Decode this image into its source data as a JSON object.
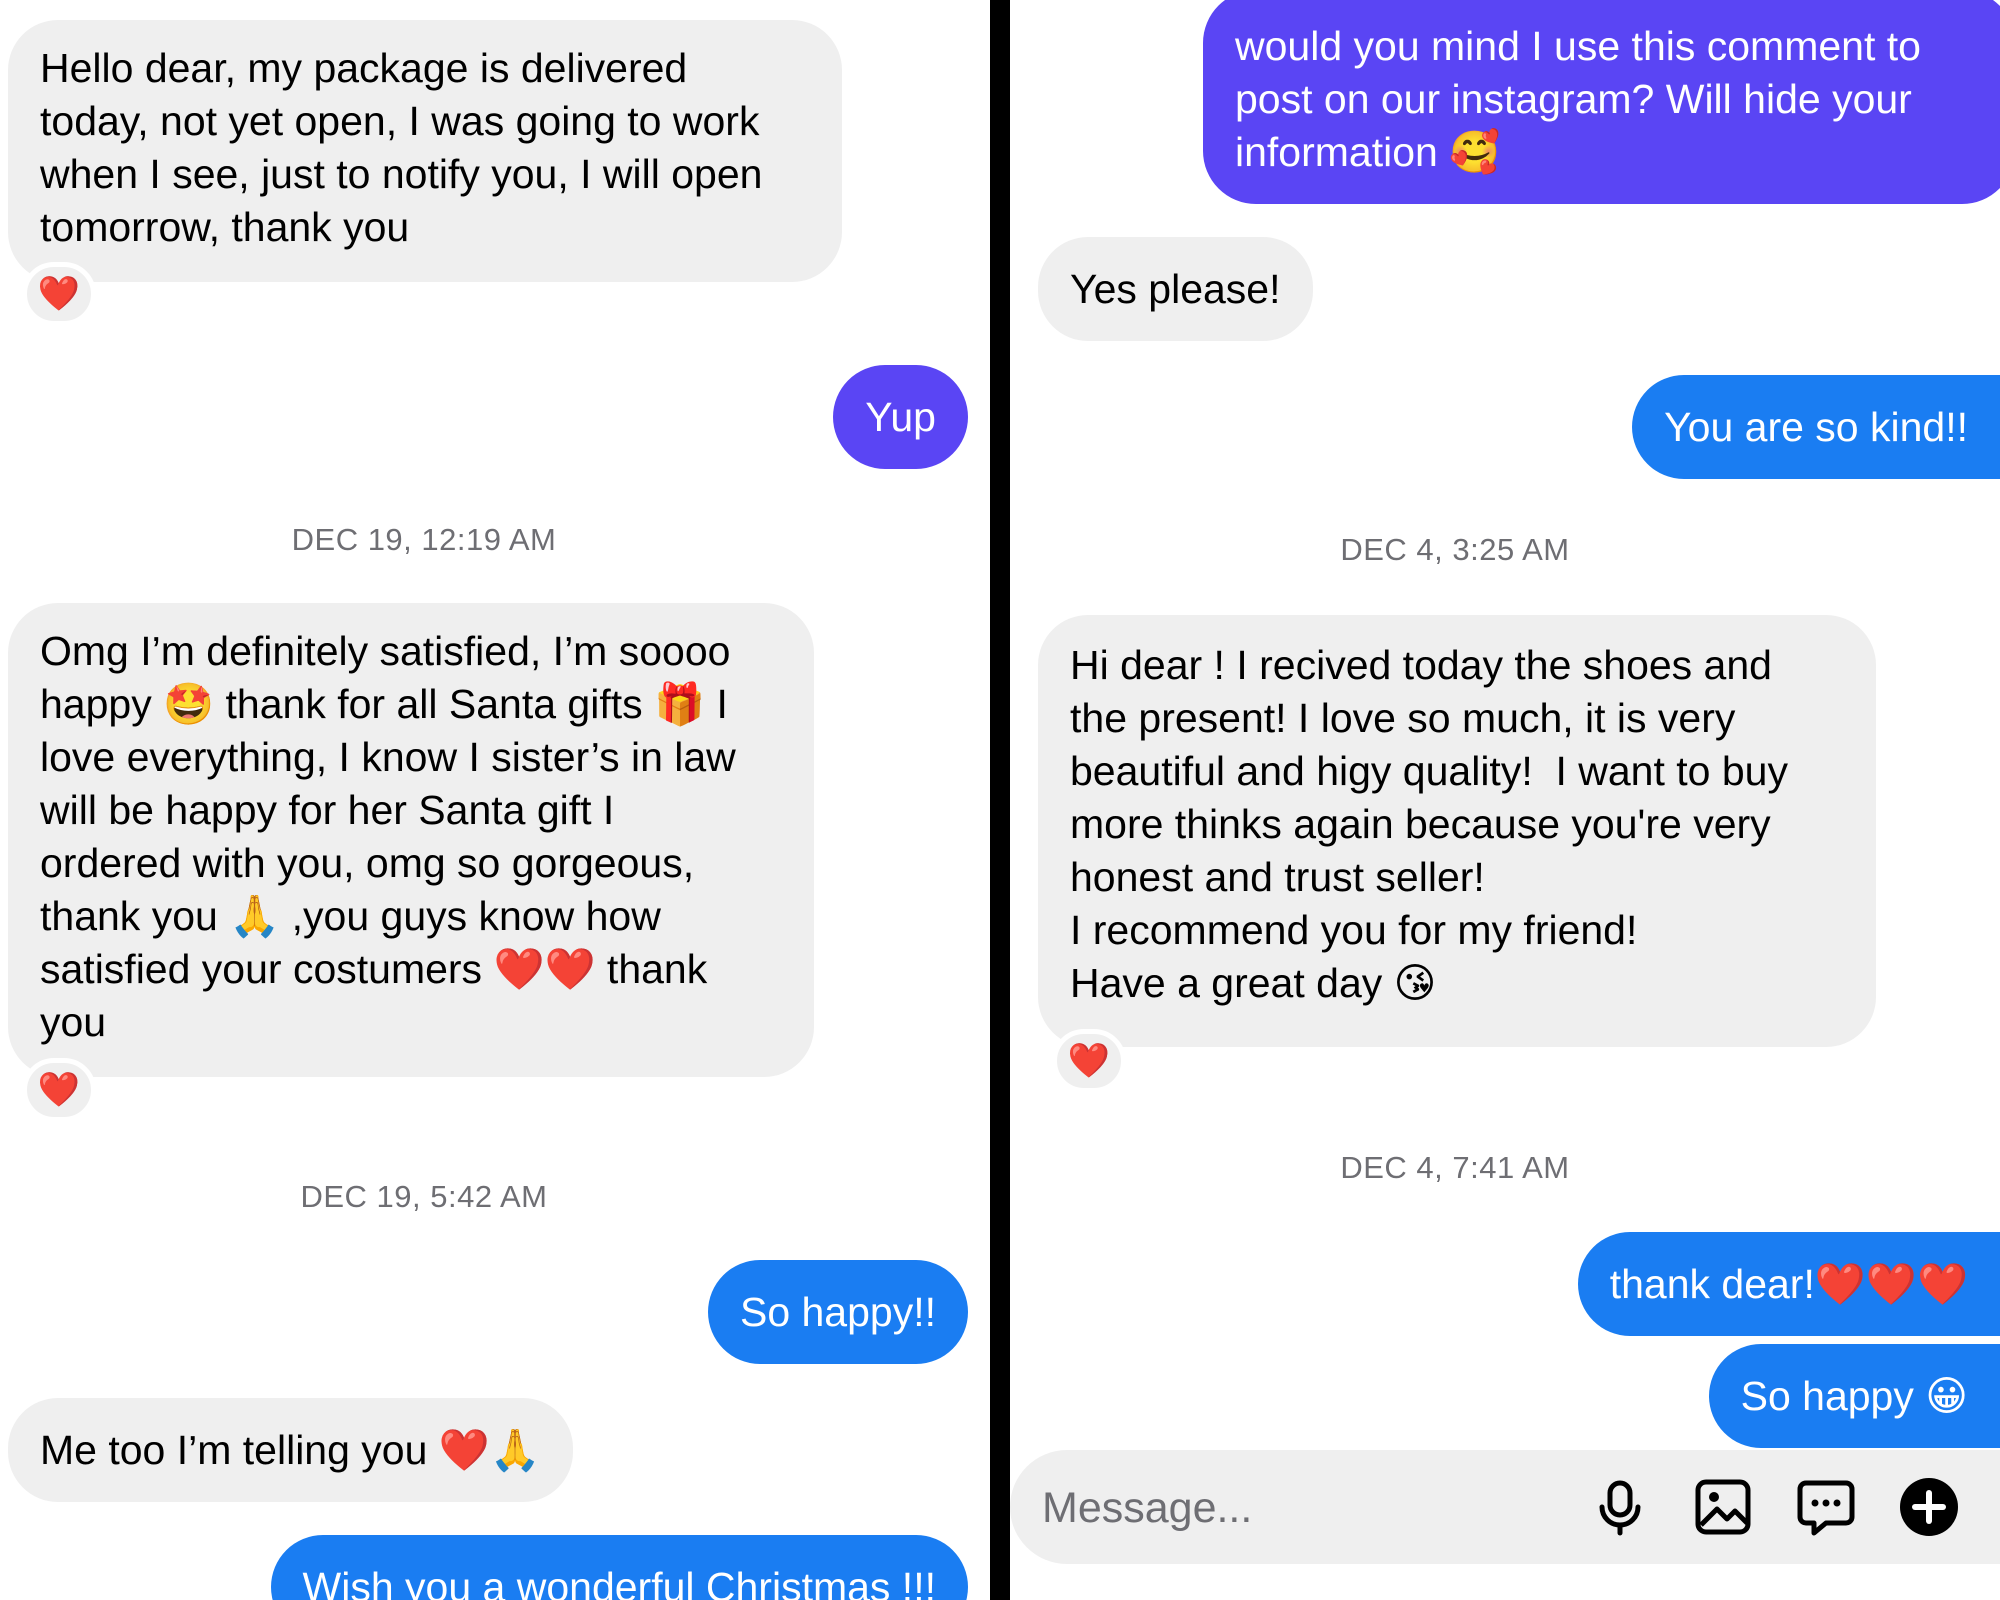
{
  "left": {
    "messages": [
      {
        "text": "Hello dear, my package is delivered\ntoday, not yet open, I was going to work\nwhen I see, just to notify you, I will open\ntomorrow, thank you",
        "reaction": "❤️"
      },
      {
        "text": "Yup"
      },
      {
        "timestamp": "DEC 19, 12:19 AM"
      },
      {
        "text": "Omg I’m definitely satisfied, I’m soooo\nhappy 🤩 thank for all Santa gifts 🎁 I\nlove everything, I know I sister’s in law\nwill be happy for her Santa gift I\nordered with you, omg so gorgeous,\nthank you 🙏 ,you guys know how\nsatisfied your costumers ❤️❤️ thank\nyou",
        "reaction": "❤️"
      },
      {
        "timestamp": "DEC 19, 5:42 AM"
      },
      {
        "text": "So happy!!"
      },
      {
        "text": "Me too I’m telling you ❤️🙏"
      },
      {
        "text": "Wish you a wonderful Christmas !!!"
      }
    ]
  },
  "right": {
    "messages": [
      {
        "text": "would you mind I use this comment to\npost on our instagram? Will hide your\ninformation 🥰"
      },
      {
        "text": "Yes please!"
      },
      {
        "text": "You are so kind!!"
      },
      {
        "timestamp": "DEC 4, 3:25 AM"
      },
      {
        "text": "Hi dear ! I recived today the shoes and\nthe present! I love so much, it is very\nbeautiful and higy quality!  I want to buy\nmore thinks again because you're very\nhonest and trust seller!\nI recommend you for my friend!\nHave a great day 😘",
        "reaction": "❤️"
      },
      {
        "timestamp": "DEC 4, 7:41 AM"
      },
      {
        "text": "thank dear!❤️❤️❤️"
      },
      {
        "text": "So happy 😀"
      }
    ],
    "composer": {
      "placeholder": "Message...",
      "icons": [
        "microphone-icon",
        "image-icon",
        "sticker-chat-icon",
        "add-icon"
      ]
    }
  },
  "colors": {
    "incoming_bubble": "#efefef",
    "outgoing_blue": "#1a7df2",
    "outgoing_purple": "#5a45f4",
    "timestamp": "#6e6e73",
    "divider": "#000000"
  }
}
